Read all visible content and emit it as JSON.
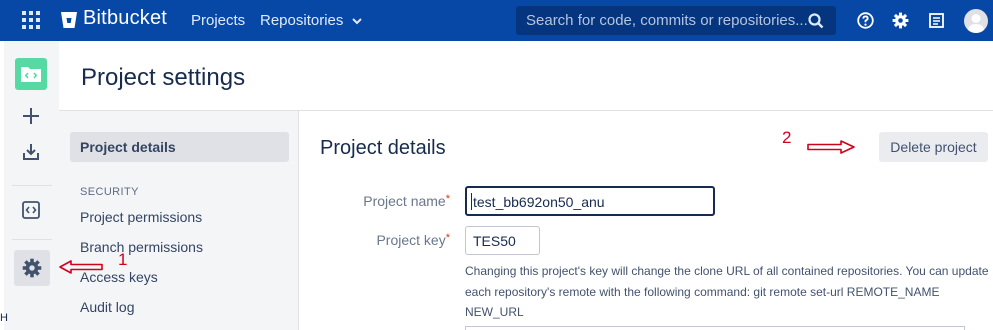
{
  "topbar": {
    "brand": "Bitbucket",
    "nav": {
      "projects": "Projects",
      "repositories": "Repositories"
    },
    "search_placeholder": "Search for code, commits or repositories...",
    "colors": {
      "background": "#0747a6",
      "search": "#05357f"
    },
    "icons": [
      "app-switcher-icon",
      "bitbucket-logo-icon",
      "search-icon",
      "help-icon",
      "settings-icon",
      "inbox-icon",
      "user-avatar-icon"
    ]
  },
  "rail": {
    "project_avatar_color": "#57d9a3",
    "icons": [
      "project-avatar-icon",
      "create-icon",
      "clone-icon",
      "repository-icon",
      "project-settings-icon"
    ]
  },
  "page": {
    "title": "Project settings"
  },
  "settings_nav": {
    "active": "Project details",
    "section_label": "SECURITY",
    "items": [
      "Project permissions",
      "Branch permissions",
      "Access keys",
      "Audit log"
    ]
  },
  "main": {
    "heading": "Project details",
    "delete_button": "Delete project",
    "fields": {
      "name_label": "Project name",
      "name_value": "test_bb692on50_anu",
      "key_label": "Project key",
      "key_value": "TES50",
      "required_mark": "*"
    },
    "help_text": "Changing this project's key will change the clone URL of all contained repositories. You can update each repository's remote with the following command: git remote set-url REMOTE_NAME NEW_URL"
  },
  "annotations": {
    "marker_1": "1",
    "marker_2": "2",
    "color": "#d0021b"
  },
  "edge_text": "H"
}
